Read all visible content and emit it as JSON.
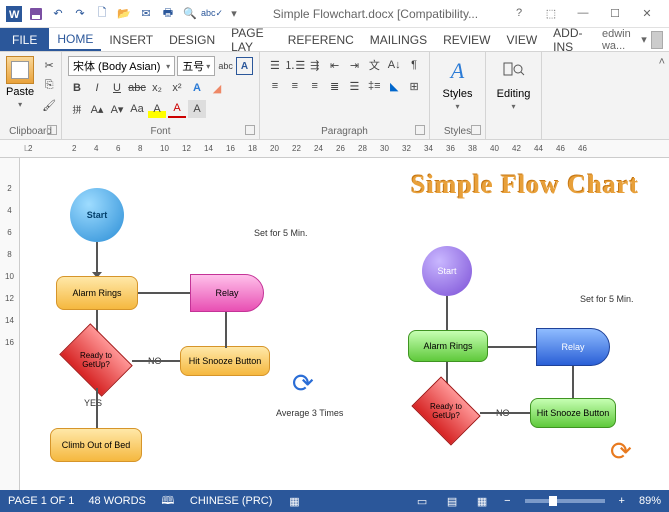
{
  "titlebar": {
    "title": "Simple Flowchart.docx [Compatibility..."
  },
  "tabs": {
    "file": "FILE",
    "items": [
      "HOME",
      "INSERT",
      "DESIGN",
      "PAGE LAY",
      "REFERENC",
      "MAILINGS",
      "REVIEW",
      "VIEW",
      "ADD-INS"
    ],
    "active": "HOME",
    "user": "edwin wa..."
  },
  "ribbon": {
    "clipboard": {
      "paste": "Paste",
      "label": "Clipboard"
    },
    "font": {
      "name": "宋体 (Body Asian)",
      "size": "五号",
      "label": "Font"
    },
    "paragraph": {
      "label": "Paragraph"
    },
    "styles": {
      "btn": "Styles",
      "label": "Styles"
    },
    "editing": {
      "btn": "Editing",
      "label": ""
    }
  },
  "ruler_h": [
    "2",
    "",
    "2",
    "4",
    "6",
    "8",
    "10",
    "12",
    "14",
    "16",
    "18",
    "20",
    "22",
    "24",
    "26",
    "28",
    "30",
    "32",
    "34",
    "36",
    "38",
    "40",
    "42",
    "44",
    "46",
    "46"
  ],
  "ruler_v": [
    "",
    "2",
    "4",
    "6",
    "8",
    "10",
    "12",
    "14",
    "16"
  ],
  "doc": {
    "title": "Simple Flow Chart",
    "left": {
      "start": "Start",
      "alarm": "Alarm Rings",
      "relay": "Relay",
      "decision": "Ready to GetUp?",
      "hit": "Hit Snooze Button",
      "climb": "Climb Out of Bed",
      "no": "NO",
      "yes": "YES",
      "set": "Set for 5 Min.",
      "avg": "Average 3 Times"
    },
    "right": {
      "start": "Start",
      "alarm": "Alarm Rings",
      "relay": "Relay",
      "decision": "Ready to GetUp?",
      "hit": "Hit Snooze Button",
      "no": "NO",
      "set": "Set for 5 Min."
    }
  },
  "status": {
    "page": "PAGE 1 OF 1",
    "words": "48 WORDS",
    "lang": "CHINESE (PRC)",
    "zoom": "89%"
  }
}
